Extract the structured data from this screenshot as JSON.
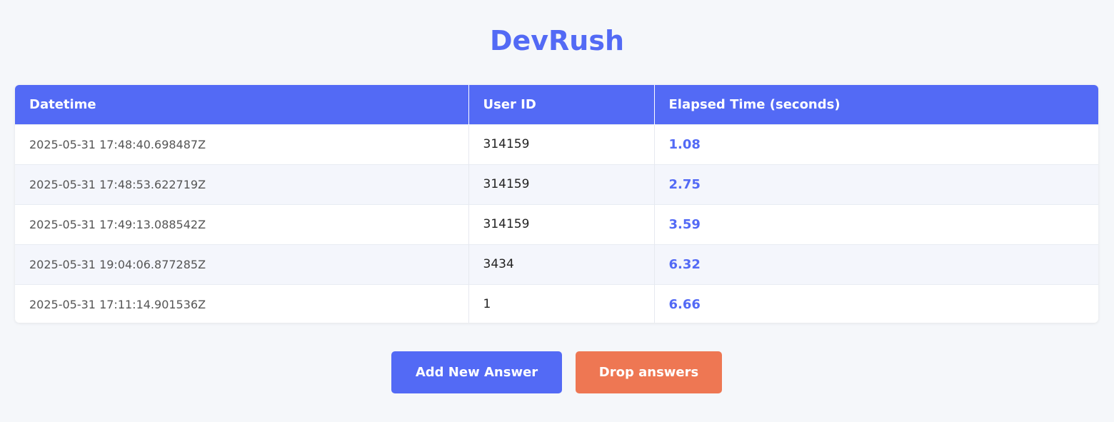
{
  "app": {
    "title": "DevRush"
  },
  "table": {
    "headers": [
      "Datetime",
      "User ID",
      "Elapsed Time (seconds)"
    ],
    "rows": [
      {
        "datetime": "2025-05-31 17:48:40.698487Z",
        "user_id": "314159",
        "elapsed": "1.08"
      },
      {
        "datetime": "2025-05-31 17:48:53.622719Z",
        "user_id": "314159",
        "elapsed": "2.75"
      },
      {
        "datetime": "2025-05-31 17:49:13.088542Z",
        "user_id": "314159",
        "elapsed": "3.59"
      },
      {
        "datetime": "2025-05-31 19:04:06.877285Z",
        "user_id": "3434",
        "elapsed": "6.32"
      },
      {
        "datetime": "2025-05-31 17:11:14.901536Z",
        "user_id": "1",
        "elapsed": "6.66"
      }
    ]
  },
  "actions": {
    "add_label": "Add New Answer",
    "drop_label": "Drop answers"
  },
  "colors": {
    "accent": "#536af5",
    "danger": "#ee7753",
    "background": "#f5f7fa"
  }
}
